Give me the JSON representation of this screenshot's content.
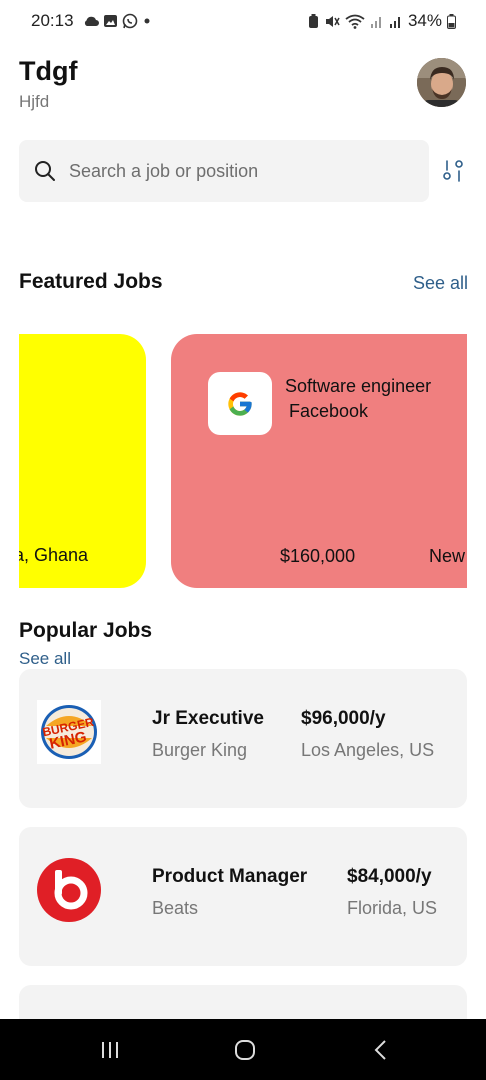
{
  "status_bar": {
    "time": "20:13",
    "battery": "34%"
  },
  "header": {
    "title": "Tdgf",
    "subtitle": "Hjfd"
  },
  "search": {
    "placeholder": "Search a job or position"
  },
  "featured": {
    "heading": "Featured Jobs",
    "see_all": "See all",
    "cards": [
      {
        "location": "a, Ghana",
        "color": "#ffff00"
      },
      {
        "role": "Software engineer",
        "company": "Facebook",
        "salary": "$160,000",
        "tag": "New",
        "color": "#f07f7f",
        "logo": "google-logo"
      }
    ]
  },
  "popular": {
    "heading": "Popular Jobs",
    "see_all": "See all",
    "jobs": [
      {
        "role": "Jr Executive",
        "company": "Burger King",
        "salary": "$96,000/y",
        "location": "Los Angeles, US",
        "logo": "burger-king-logo"
      },
      {
        "role": "Product Manager",
        "company": "Beats",
        "salary": "$84,000/y",
        "location": "Florida, US",
        "logo": "beats-logo"
      }
    ]
  },
  "colors": {
    "accent_link": "#2f5f8a",
    "card_background": "#f3f3f3"
  }
}
